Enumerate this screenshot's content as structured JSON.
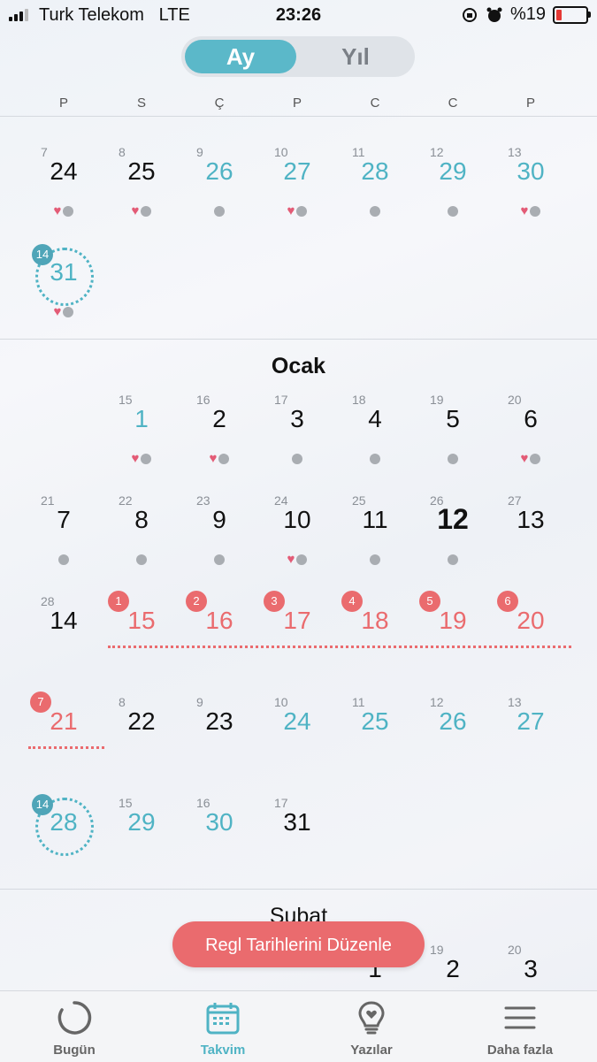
{
  "status_bar": {
    "carrier": "Turk Telekom",
    "network": "LTE",
    "time": "23:26",
    "battery_text": "%19",
    "battery_level": 0.19
  },
  "segment": {
    "month_label": "Ay",
    "year_label": "Yıl"
  },
  "weekdays": [
    "P",
    "S",
    "Ç",
    "P",
    "C",
    "C",
    "P"
  ],
  "months": {
    "ocak": "Ocak",
    "subat": "Subat"
  },
  "cycle_days": {
    "d7": "7",
    "d8": "8",
    "d9": "9",
    "d10": "10",
    "d11": "11",
    "d12": "12",
    "d13": "13",
    "d14": "14",
    "d15": "15",
    "d16": "16",
    "d17": "17",
    "d18": "18",
    "d19": "19",
    "d20": "20",
    "d21": "21",
    "d22": "22",
    "d23": "23",
    "d24": "24",
    "d25": "25",
    "d26": "26",
    "d27": "27",
    "d28": "28",
    "e8": "8",
    "e9": "9",
    "e10": "10",
    "e11": "11",
    "e12": "12",
    "e13": "13",
    "e14": "14",
    "e15": "15",
    "e16": "16",
    "e17": "17",
    "f19": "19",
    "f20": "20"
  },
  "dates": {
    "dec24": "24",
    "dec25": "25",
    "dec26": "26",
    "dec27": "27",
    "dec28": "28",
    "dec29": "29",
    "dec30": "30",
    "dec31": "31",
    "j1": "1",
    "j2": "2",
    "j3": "3",
    "j4": "4",
    "j5": "5",
    "j6": "6",
    "j7": "7",
    "j8": "8",
    "j9": "9",
    "j10": "10",
    "j11": "11",
    "j12": "12",
    "j13": "13",
    "j14": "14",
    "j15": "15",
    "j16": "16",
    "j17": "17",
    "j18": "18",
    "j19": "19",
    "j20": "20",
    "j21": "21",
    "j22": "22",
    "j23": "23",
    "j24": "24",
    "j25": "25",
    "j26": "26",
    "j27": "27",
    "j28": "28",
    "j29": "29",
    "j30": "30",
    "j31": "31",
    "f1": "1",
    "f2": "2",
    "f3": "3"
  },
  "period_badges": [
    "1",
    "2",
    "3",
    "4",
    "5",
    "6",
    "7"
  ],
  "ovulation_badges": {
    "dec": "14",
    "jan": "14"
  },
  "edit_button": "Regl Tarihlerini Düzenle",
  "tabs": [
    {
      "label": "Bugün"
    },
    {
      "label": "Takvim"
    },
    {
      "label": "Yazılar"
    },
    {
      "label": "Daha fazla"
    }
  ],
  "colors": {
    "accent_teal": "#4fb3c4",
    "period_red": "#ea6b6e",
    "heart_pink": "#e35b76"
  }
}
